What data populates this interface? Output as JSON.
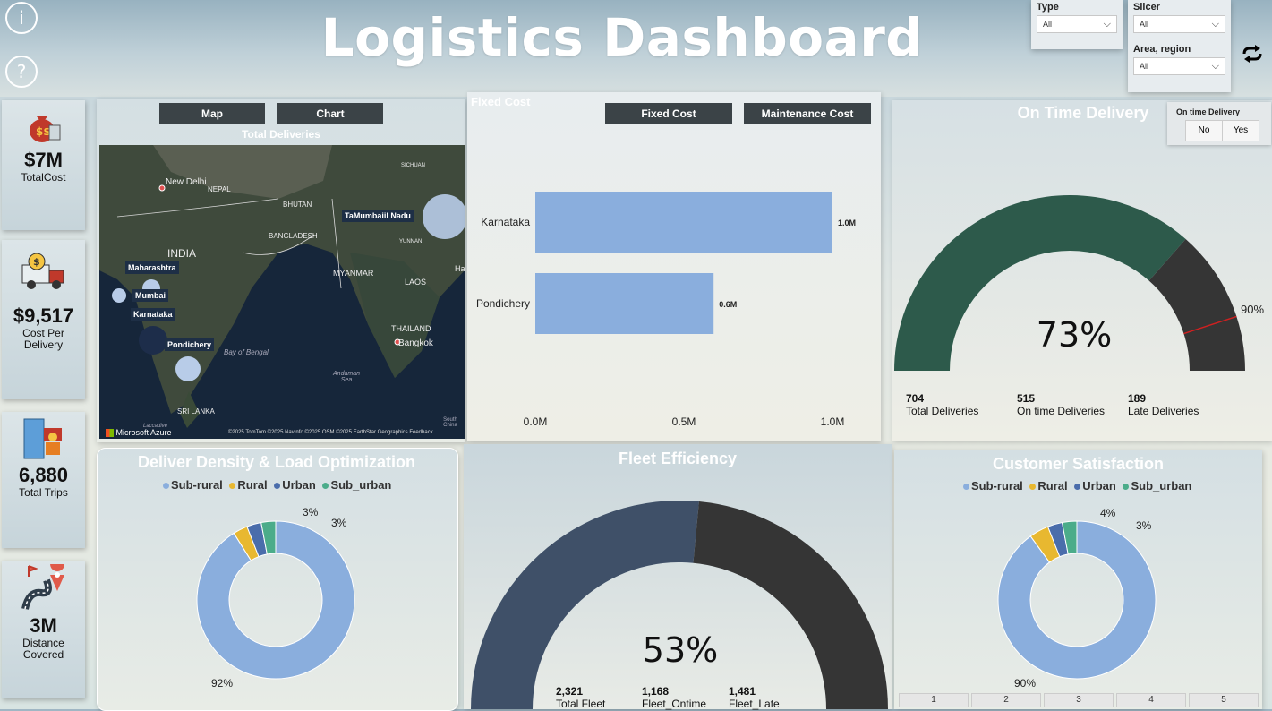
{
  "header": {
    "title": "Logistics Dashboard",
    "info_icon": "info-icon",
    "help_icon": "question-icon"
  },
  "slicers": {
    "type": {
      "label": "Type",
      "value": "All"
    },
    "slicer": {
      "label": "Slicer",
      "value": "All"
    },
    "area": {
      "label": "Area, region",
      "value": "All"
    }
  },
  "kpis": [
    {
      "value": "$7M",
      "caption": "TotalCost",
      "icon": "money-bag-icon"
    },
    {
      "value": "$9,517",
      "caption": "Cost Per Delivery",
      "icon": "delivery-truck-icon"
    },
    {
      "value": "6,880",
      "caption": "Total Trips",
      "icon": "cargo-icon"
    },
    {
      "value": "3M",
      "caption": "Distance Covered",
      "icon": "route-pin-icon"
    }
  ],
  "map_panel": {
    "tab_map": "Map",
    "tab_chart": "Chart",
    "title": "Total Deliveries",
    "labels": {
      "new_delhi": "New Delhi",
      "nepal": "NEPAL",
      "bhutan": "BHUTAN",
      "bangladesh": "BANGLADESH",
      "india": "INDIA",
      "myanmar": "MYANMAR",
      "laos": "LAOS",
      "thailand": "THAILAND",
      "bangkok": "Bangkok",
      "bay": "Bay of Bengal",
      "srilanka": "SRI LANKA",
      "sichuan": "SICHUAN",
      "yunnan": "YUNNAN",
      "andaman": "Andaman Sea",
      "ha": "Ha",
      "south": "South China",
      "lacad": "Laccadive"
    },
    "bubble_labels": [
      "Maharashtra",
      "Mumbai",
      "Karnataka",
      "Pondichery",
      "TaMumbaiil Nadu"
    ],
    "brand": "Microsoft Azure",
    "credits": "©2025 TomTom  ©2025 NavInfo  ©2025 OSM  ©2025 EarthStar Geographics  Feedback"
  },
  "cost_panel": {
    "title": "Fixed Cost",
    "btn_fixed": "Fixed Cost",
    "btn_maint": "Maintenance Cost"
  },
  "chart_data": [
    {
      "type": "bar",
      "orientation": "horizontal",
      "title": "Fixed Cost",
      "categories": [
        "Karnataka",
        "Pondichery"
      ],
      "values": [
        1.0,
        0.6
      ],
      "unit": "M",
      "data_labels": [
        "1.0M",
        "0.6M"
      ],
      "x_ticks": [
        "0.0M",
        "0.5M",
        "1.0M"
      ],
      "xlim": [
        0,
        1.0
      ],
      "color": "#8aaedd"
    },
    {
      "type": "gauge",
      "title": "On Time Delivery",
      "value": 73,
      "target": 90,
      "value_label": "73%",
      "target_label": "90%",
      "colors": {
        "value": "#2d5a4b",
        "remainder": "#353535",
        "target": "#d02020"
      }
    },
    {
      "type": "pie",
      "title": "Deliver Density & Load Optimization",
      "donut": true,
      "labels": [
        "Sub-rural",
        "Rural",
        "Urban",
        "Sub_urban"
      ],
      "values": [
        92,
        3,
        3,
        3
      ],
      "shown_labels": [
        "92%",
        "3%",
        "3%"
      ],
      "colors": [
        "#8aaedd",
        "#e8b830",
        "#4a6dab",
        "#4bac8a"
      ]
    },
    {
      "type": "gauge",
      "title": "Fleet Efficiency",
      "value": 53,
      "value_label": "53%",
      "colors": {
        "value": "#3f5068",
        "remainder": "#353535"
      }
    },
    {
      "type": "pie",
      "title": "Customer Satisfaction",
      "donut": true,
      "labels": [
        "Sub-rural",
        "Rural",
        "Urban",
        "Sub_urban"
      ],
      "values": [
        90,
        4,
        3,
        3
      ],
      "shown_labels": [
        "90%",
        "4%",
        "3%"
      ],
      "colors": [
        "#8aaedd",
        "#e8b830",
        "#4a6dab",
        "#4bac8a"
      ]
    }
  ],
  "ontime_panel": {
    "title": "On Time Delivery",
    "toggle_label": "On time Delivery",
    "toggle_no": "No",
    "toggle_yes": "Yes",
    "center": "73%",
    "target": "90%",
    "stats": [
      {
        "n": "704",
        "c": "Total Deliveries"
      },
      {
        "n": "515",
        "c": "On time Deliveries"
      },
      {
        "n": "189",
        "c": "Late Deliveries"
      }
    ]
  },
  "density_panel": {
    "title": "Deliver Density & Load Optimization",
    "legend": [
      "Sub-rural",
      "Rural",
      "Urban",
      "Sub_urban"
    ],
    "lbl_big": "92%",
    "lbl_a": "3%",
    "lbl_b": "3%"
  },
  "fleet_panel": {
    "title": "Fleet Efficiency",
    "center": "53%",
    "stats": [
      {
        "n": "2,321",
        "c": "Total Fleet"
      },
      {
        "n": "1,168",
        "c": "Fleet_Ontime"
      },
      {
        "n": "1,481",
        "c": "Fleet_Late"
      }
    ]
  },
  "satisfaction_panel": {
    "title": "Customer Satisfaction",
    "legend": [
      "Sub-rural",
      "Rural",
      "Urban",
      "Sub_urban"
    ],
    "lbl_big": "90%",
    "lbl_a": "4%",
    "lbl_b": "3%",
    "pages": [
      "1",
      "2",
      "3",
      "4",
      "5"
    ]
  }
}
